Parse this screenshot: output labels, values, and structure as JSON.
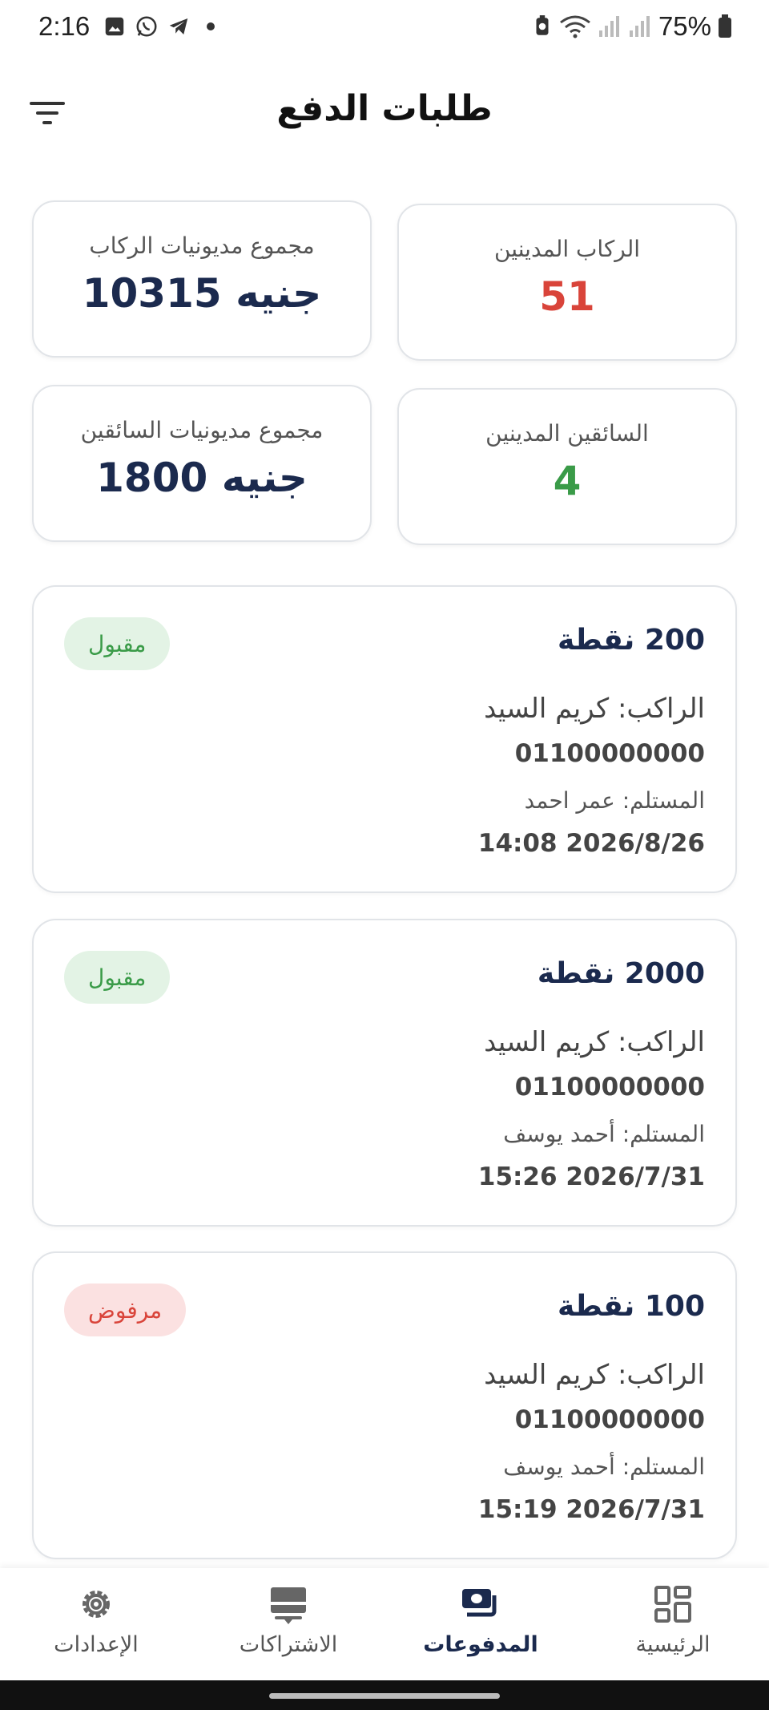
{
  "status_bar": {
    "time": "2:16",
    "battery": "75%",
    "icons": [
      "gallery-icon",
      "whatsapp-icon",
      "telegram-icon",
      "dot-icon",
      "wifi-icon",
      "signal-icon",
      "battery-icon"
    ]
  },
  "header": {
    "title": "طلبات الدفع",
    "filter_icon": "filter-icon"
  },
  "stats": [
    {
      "label": "الركاب المدينين",
      "value": "51",
      "color": "#d9443a"
    },
    {
      "label": "مجموع مديونيات الركاب",
      "value": "10315 جنيه",
      "color": "#1b2a4e"
    },
    {
      "label": "السائقين المدينين",
      "value": "4",
      "color": "#3a9b48"
    },
    {
      "label": "مجموع مديونيات السائقين",
      "value": "1800 جنيه",
      "color": "#1b2a4e"
    }
  ],
  "payments": [
    {
      "points": "200 نقطة",
      "rider": "الراكب: كريم السيد",
      "phone": "01100000000",
      "recipient": "المستلم: عمر احمد",
      "date": "14:08 2026/8/26",
      "status": "مقبول"
    },
    {
      "points": "2000 نقطة",
      "rider": "الراكب: كريم السيد",
      "phone": "01100000000",
      "recipient": "المستلم: أحمد يوسف",
      "date": "15:26 2026/7/31",
      "status": "مقبول"
    },
    {
      "points": "100 نقطة",
      "rider": "الراكب: كريم السيد",
      "phone": "01100000000",
      "recipient": "المستلم: أحمد يوسف",
      "date": "15:19 2026/7/31",
      "status": "مرفوض"
    }
  ],
  "nav": {
    "items": [
      {
        "label": "الرئيسية",
        "icon": "dashboard-icon"
      },
      {
        "label": "المدفوعات",
        "icon": "payments-icon",
        "active": true
      },
      {
        "label": "الاشتراكات",
        "icon": "subscriptions-icon"
      },
      {
        "label": "الإعدادات",
        "icon": "settings-icon"
      }
    ]
  },
  "colors": {
    "accent": "#1b2a4e",
    "accepted_bg": "#e3f3e5",
    "accepted_text": "#3a9b48",
    "rejected_bg": "#fbe1e1",
    "rejected_text": "#d9443a"
  }
}
